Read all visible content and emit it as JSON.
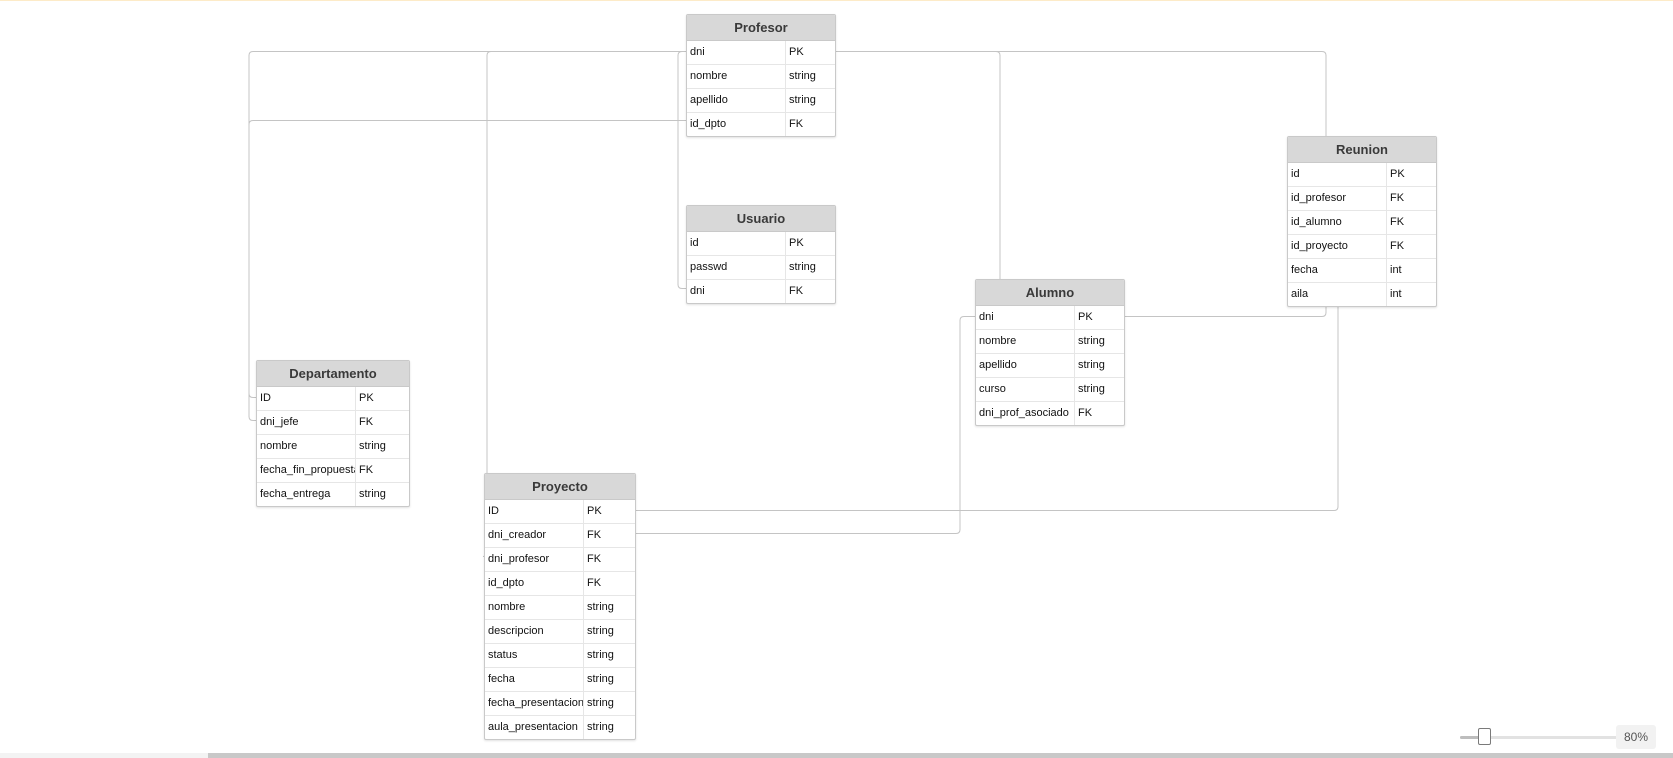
{
  "diagram": {
    "entities": [
      {
        "id": "profesor",
        "title": "Profesor",
        "fields": [
          {
            "name": "dni",
            "type": "PK"
          },
          {
            "name": "nombre",
            "type": "string"
          },
          {
            "name": "apellido",
            "type": "string"
          },
          {
            "name": "id_dpto",
            "type": "FK"
          }
        ]
      },
      {
        "id": "usuario",
        "title": "Usuario",
        "fields": [
          {
            "name": "id",
            "type": "PK"
          },
          {
            "name": "passwd",
            "type": "string"
          },
          {
            "name": "dni",
            "type": "FK"
          }
        ]
      },
      {
        "id": "reunion",
        "title": "Reunion",
        "fields": [
          {
            "name": "id",
            "type": "PK"
          },
          {
            "name": "id_profesor",
            "type": "FK"
          },
          {
            "name": "id_alumno",
            "type": "FK"
          },
          {
            "name": "id_proyecto",
            "type": "FK"
          },
          {
            "name": "fecha",
            "type": "int"
          },
          {
            "name": "aila",
            "type": "int"
          }
        ]
      },
      {
        "id": "alumno",
        "title": "Alumno",
        "fields": [
          {
            "name": "dni",
            "type": "PK"
          },
          {
            "name": "nombre",
            "type": "string"
          },
          {
            "name": "apellido",
            "type": "string"
          },
          {
            "name": "curso",
            "type": "string"
          },
          {
            "name": "dni_prof_asociado",
            "type": "FK"
          }
        ]
      },
      {
        "id": "departamento",
        "title": "Departamento",
        "fields": [
          {
            "name": "ID",
            "type": "PK"
          },
          {
            "name": "dni_jefe",
            "type": "FK"
          },
          {
            "name": "nombre",
            "type": "string"
          },
          {
            "name": "fecha_fin_propuesta",
            "type": "FK"
          },
          {
            "name": "fecha_entrega",
            "type": "string"
          }
        ]
      },
      {
        "id": "proyecto",
        "title": "Proyecto",
        "fields": [
          {
            "name": "ID",
            "type": "PK"
          },
          {
            "name": "dni_creador",
            "type": "FK"
          },
          {
            "name": "dni_profesor",
            "type": "FK"
          },
          {
            "name": "id_dpto",
            "type": "FK"
          },
          {
            "name": "nombre",
            "type": "string"
          },
          {
            "name": "descripcion",
            "type": "string"
          },
          {
            "name": "status",
            "type": "string"
          },
          {
            "name": "fecha",
            "type": "string"
          },
          {
            "name": "fecha_presentacion",
            "type": "string"
          },
          {
            "name": "aula_presentacion",
            "type": "string"
          }
        ]
      }
    ],
    "relationships": [
      {
        "from": "usuario.dni",
        "to": "profesor.dni"
      },
      {
        "from": "departamento.dni_jefe",
        "to": "profesor.dni"
      },
      {
        "from": "departamento.ID",
        "to": "profesor.id_dpto"
      },
      {
        "from": "proyecto.dni_profesor",
        "to": "profesor.dni"
      },
      {
        "from": "alumno.dni_prof_asociado",
        "to": "profesor.dni"
      },
      {
        "from": "reunion.id_profesor",
        "to": "profesor.dni"
      },
      {
        "from": "reunion.id_alumno",
        "to": "alumno.dni"
      },
      {
        "from": "reunion.id_proyecto",
        "to": "proyecto.ID"
      },
      {
        "from": "proyecto.dni_creador",
        "to": "alumno.dni"
      }
    ]
  },
  "zoom": {
    "label": "80%",
    "level": 0.15
  }
}
